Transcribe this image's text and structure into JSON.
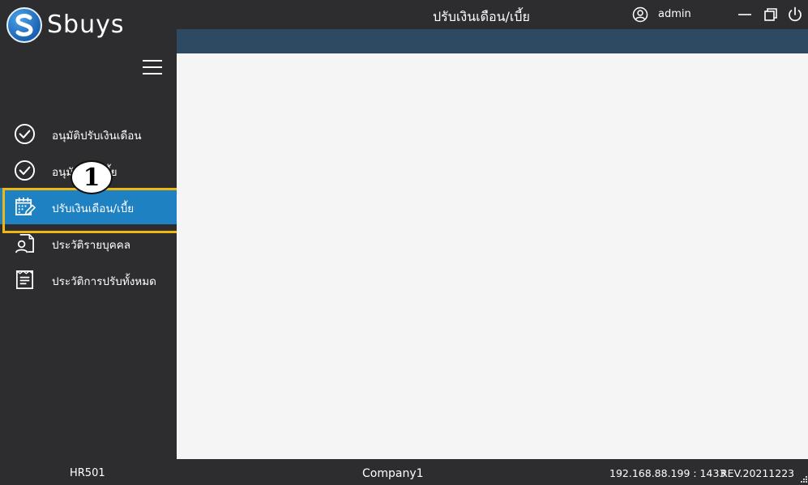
{
  "app": {
    "logo_text": "Sbuys",
    "window_title": "ปรับเงินเดือน/เบี้ย",
    "user_name": "admin"
  },
  "sidebar": {
    "items": [
      {
        "label": "อนุมัติปรับเงินเดือน",
        "icon": "check-circle-icon",
        "active": false
      },
      {
        "label": "อนุมัติปรับเบี้ย",
        "icon": "check-circle-icon",
        "active": false
      },
      {
        "label": "ปรับเงินเดือน/เบี้ย",
        "icon": "calendar-edit-icon",
        "active": true
      },
      {
        "label": "ประวัติรายบุคคล",
        "icon": "person-document-icon",
        "active": false
      },
      {
        "label": "ประวัติการปรับทั้งหมด",
        "icon": "list-document-icon",
        "active": false
      }
    ]
  },
  "annotation": {
    "callout_number": "1"
  },
  "statusbar": {
    "code": "HR501",
    "company": "Company1",
    "server": "192.168.88.199 : 1433",
    "revision": "REV.20211223"
  },
  "colors": {
    "sidebar_bg": "#2d2d30",
    "active_item": "#1e81c2",
    "highlight_border": "#f0b712",
    "subbar": "#2e4a63",
    "content_bg": "#f5f5f5"
  }
}
